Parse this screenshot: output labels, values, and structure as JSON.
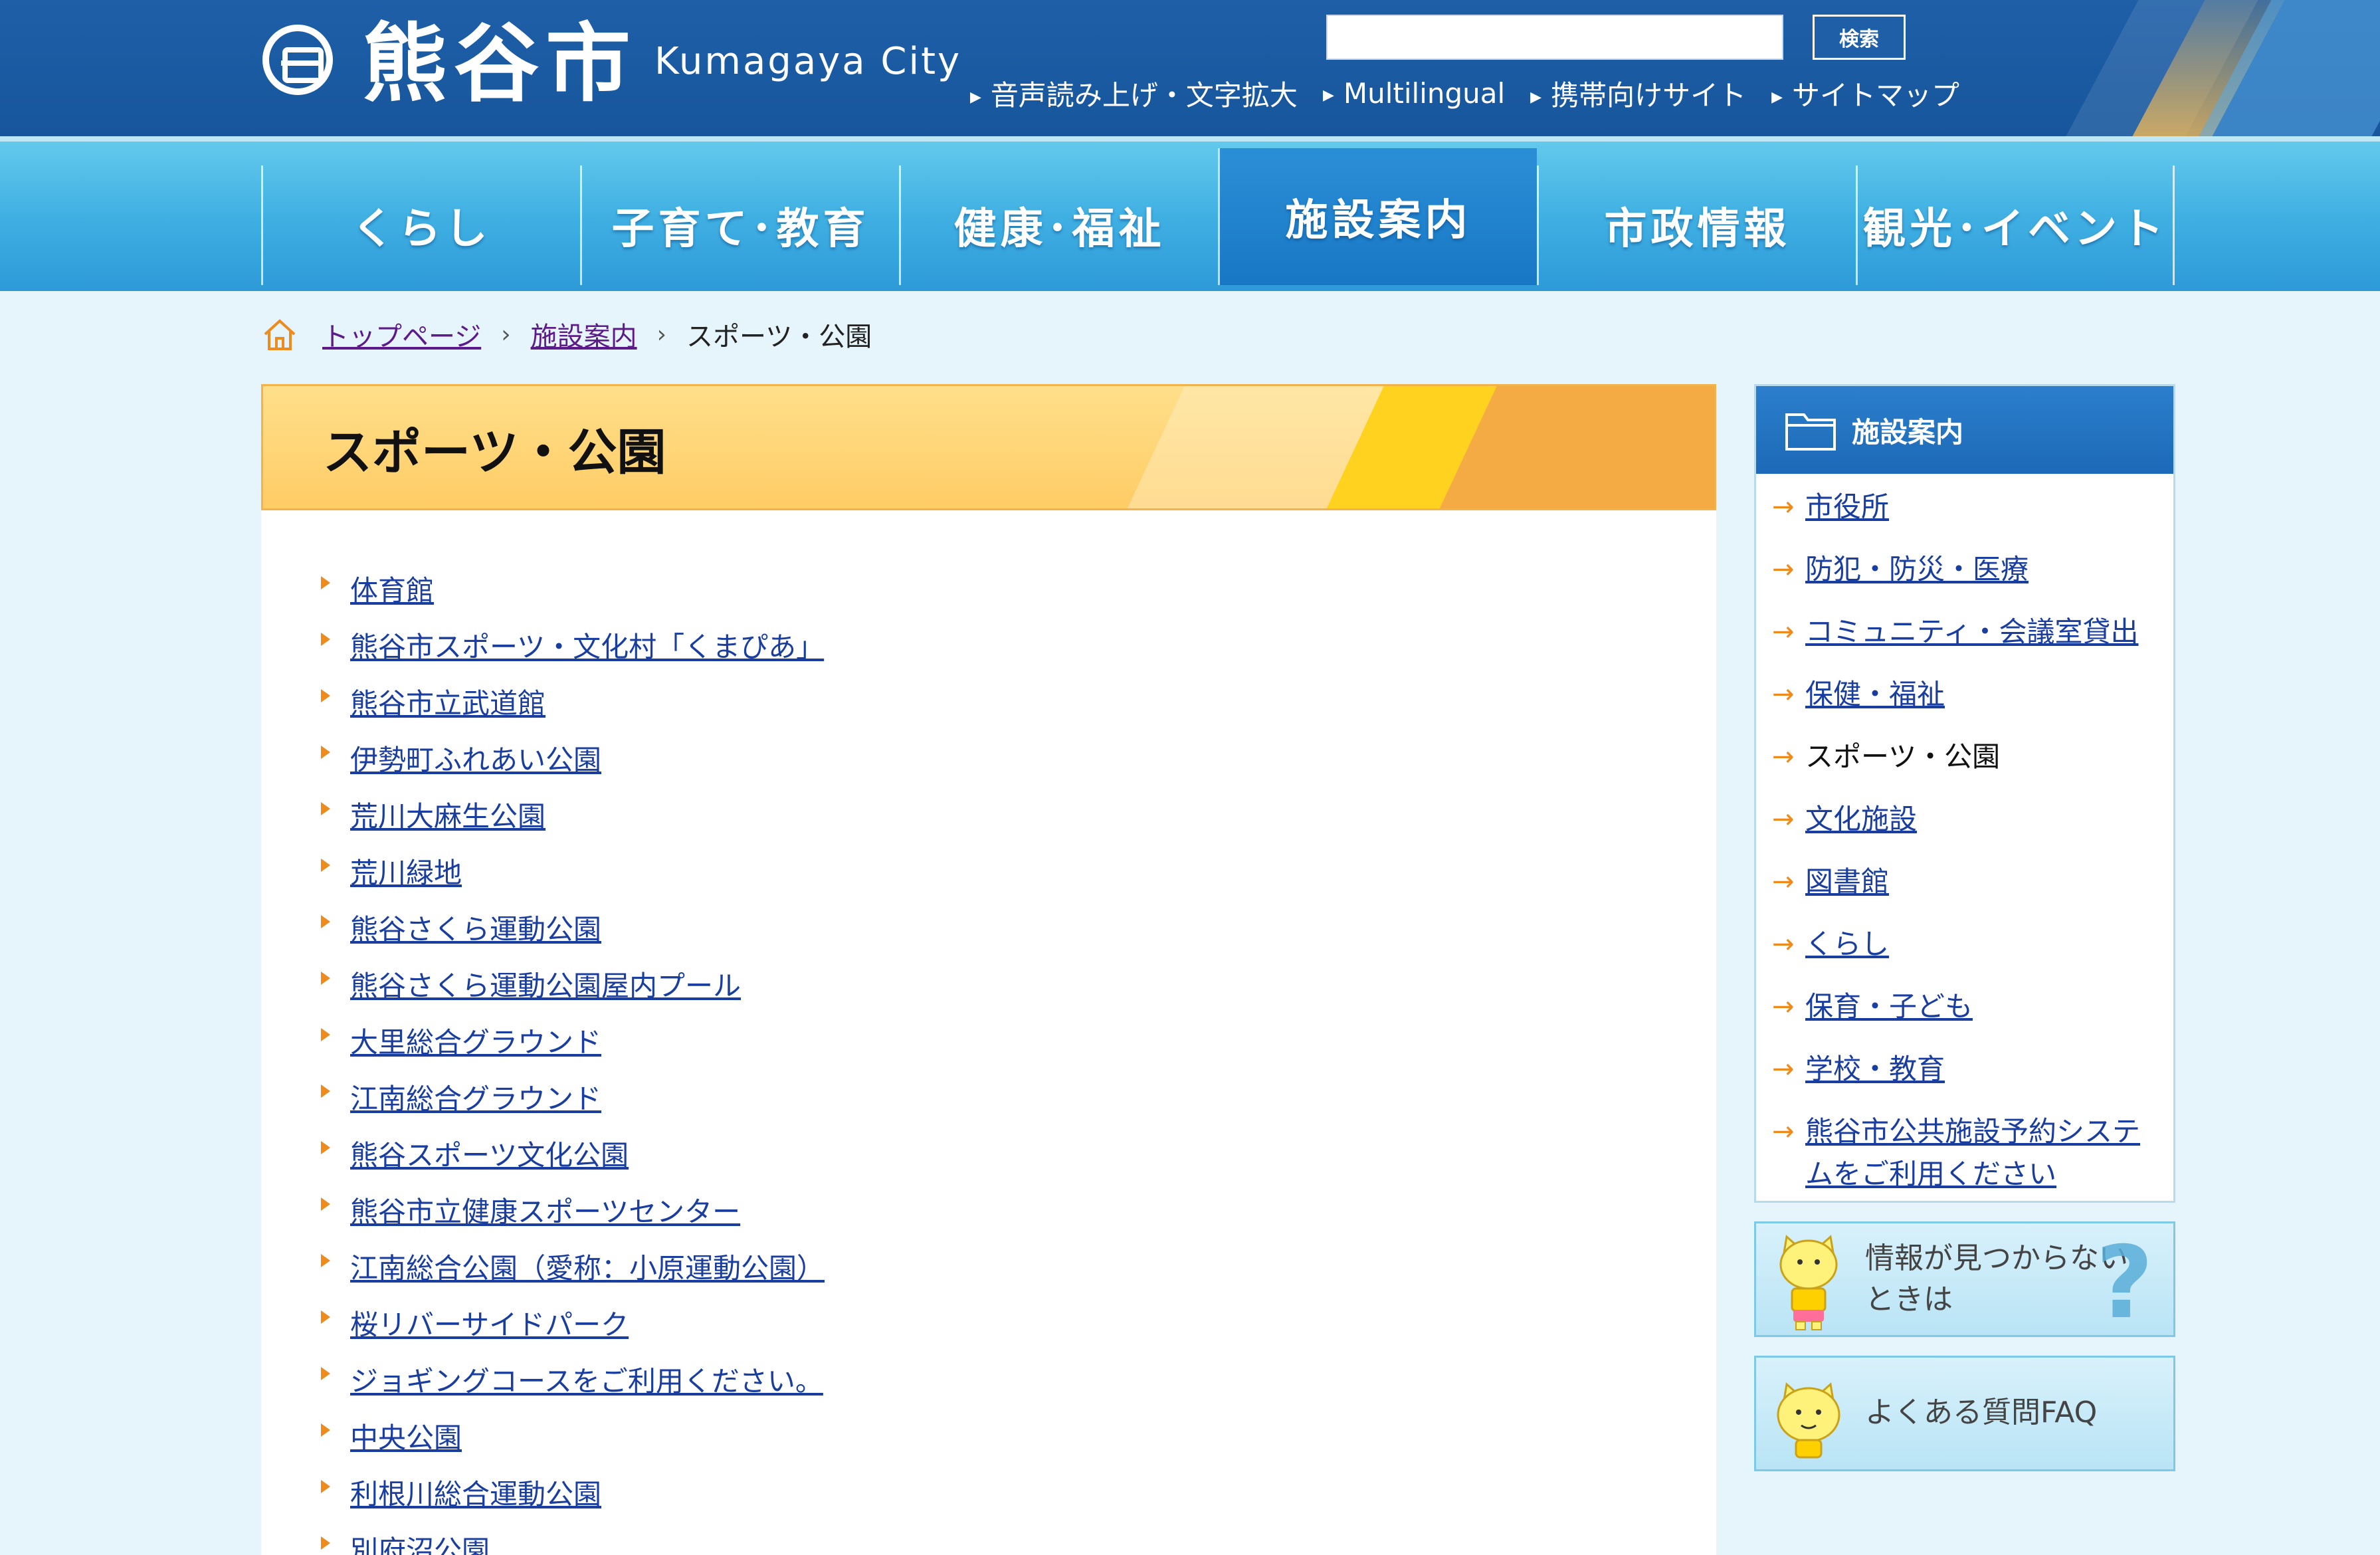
{
  "header": {
    "logo_kanji": "熊谷市",
    "logo_en": "Kumagaya City",
    "search_button": "検索",
    "util_links": [
      "音声読み上げ・文字拡大",
      "Multilingual",
      "携帯向けサイト",
      "サイトマップ"
    ]
  },
  "nav": {
    "items": [
      "くらし",
      "子育て･教育",
      "健康･福祉",
      "施設案内",
      "市政情報",
      "観光･イベント"
    ],
    "active": "施設案内"
  },
  "breadcrumb": {
    "home": "トップページ",
    "parent": "施設案内",
    "current": "スポーツ・公園"
  },
  "main": {
    "title": "スポーツ・公園",
    "links": [
      "体育館",
      "熊谷市スポーツ・文化村「くまぴあ」",
      "熊谷市立武道館",
      "伊勢町ふれあい公園",
      "荒川大麻生公園",
      "荒川緑地",
      "熊谷さくら運動公園",
      "熊谷さくら運動公園屋内プール",
      "大里総合グラウンド",
      "江南総合グラウンド",
      "熊谷スポーツ文化公園",
      "熊谷市立健康スポーツセンター",
      "江南総合公園（愛称：小原運動公園）",
      "桜リバーサイドパーク",
      "ジョギングコースをご利用ください。",
      "中央公園",
      "利根川総合運動公園",
      "別府沼公園"
    ]
  },
  "sidebar": {
    "title": "施設案内",
    "items": [
      "市役所",
      "防犯・防災・医療",
      "コミュニティ・会議室貸出",
      "保健・福祉",
      "スポーツ・公園",
      "文化施設",
      "図書館",
      "くらし",
      "保育・子ども",
      "学校・教育",
      "熊谷市公共施設予約システムをご利用ください"
    ],
    "current": "スポーツ・公園",
    "banner1_line1": "情報が見つからない",
    "banner1_line2": "ときは",
    "banner1_qmark": "?",
    "banner2": "よくある質問FAQ"
  },
  "colors": {
    "header_blue": "#1e5fa8",
    "nav_cyan": "#40b0e3",
    "title_orange": "#ffcc66",
    "link_blue": "#1a3ea0",
    "arrow_orange": "#ef8a1c"
  }
}
